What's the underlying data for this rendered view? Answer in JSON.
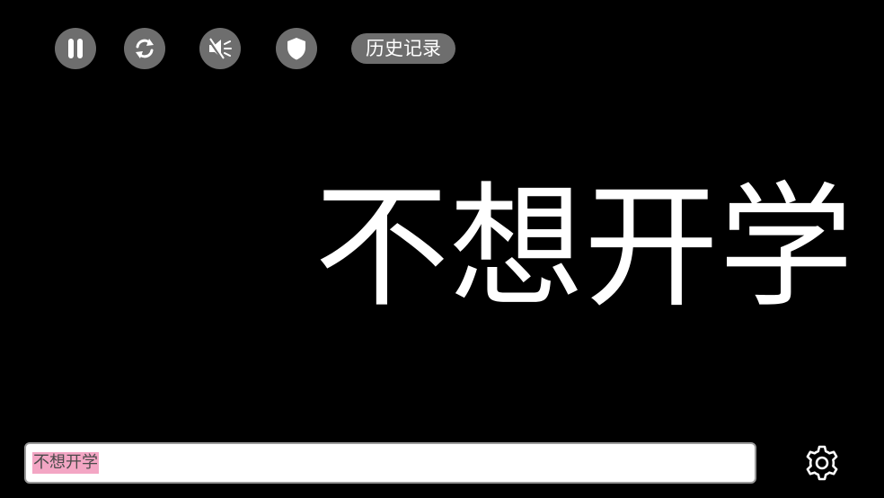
{
  "toolbar": {
    "pause_icon": "pause-icon",
    "refresh_icon": "refresh-icon",
    "mute_icon": "mute-icon",
    "shield_icon": "shield-icon",
    "history_label": "历史记录"
  },
  "display": {
    "text": "不想开学"
  },
  "input": {
    "value": "不想开学",
    "selection_color": "#f3a6c4"
  },
  "settings": {
    "icon": "gear-icon"
  },
  "colors": {
    "background": "#000000",
    "button_bg": "#6e6e6e",
    "foreground": "#ffffff"
  }
}
